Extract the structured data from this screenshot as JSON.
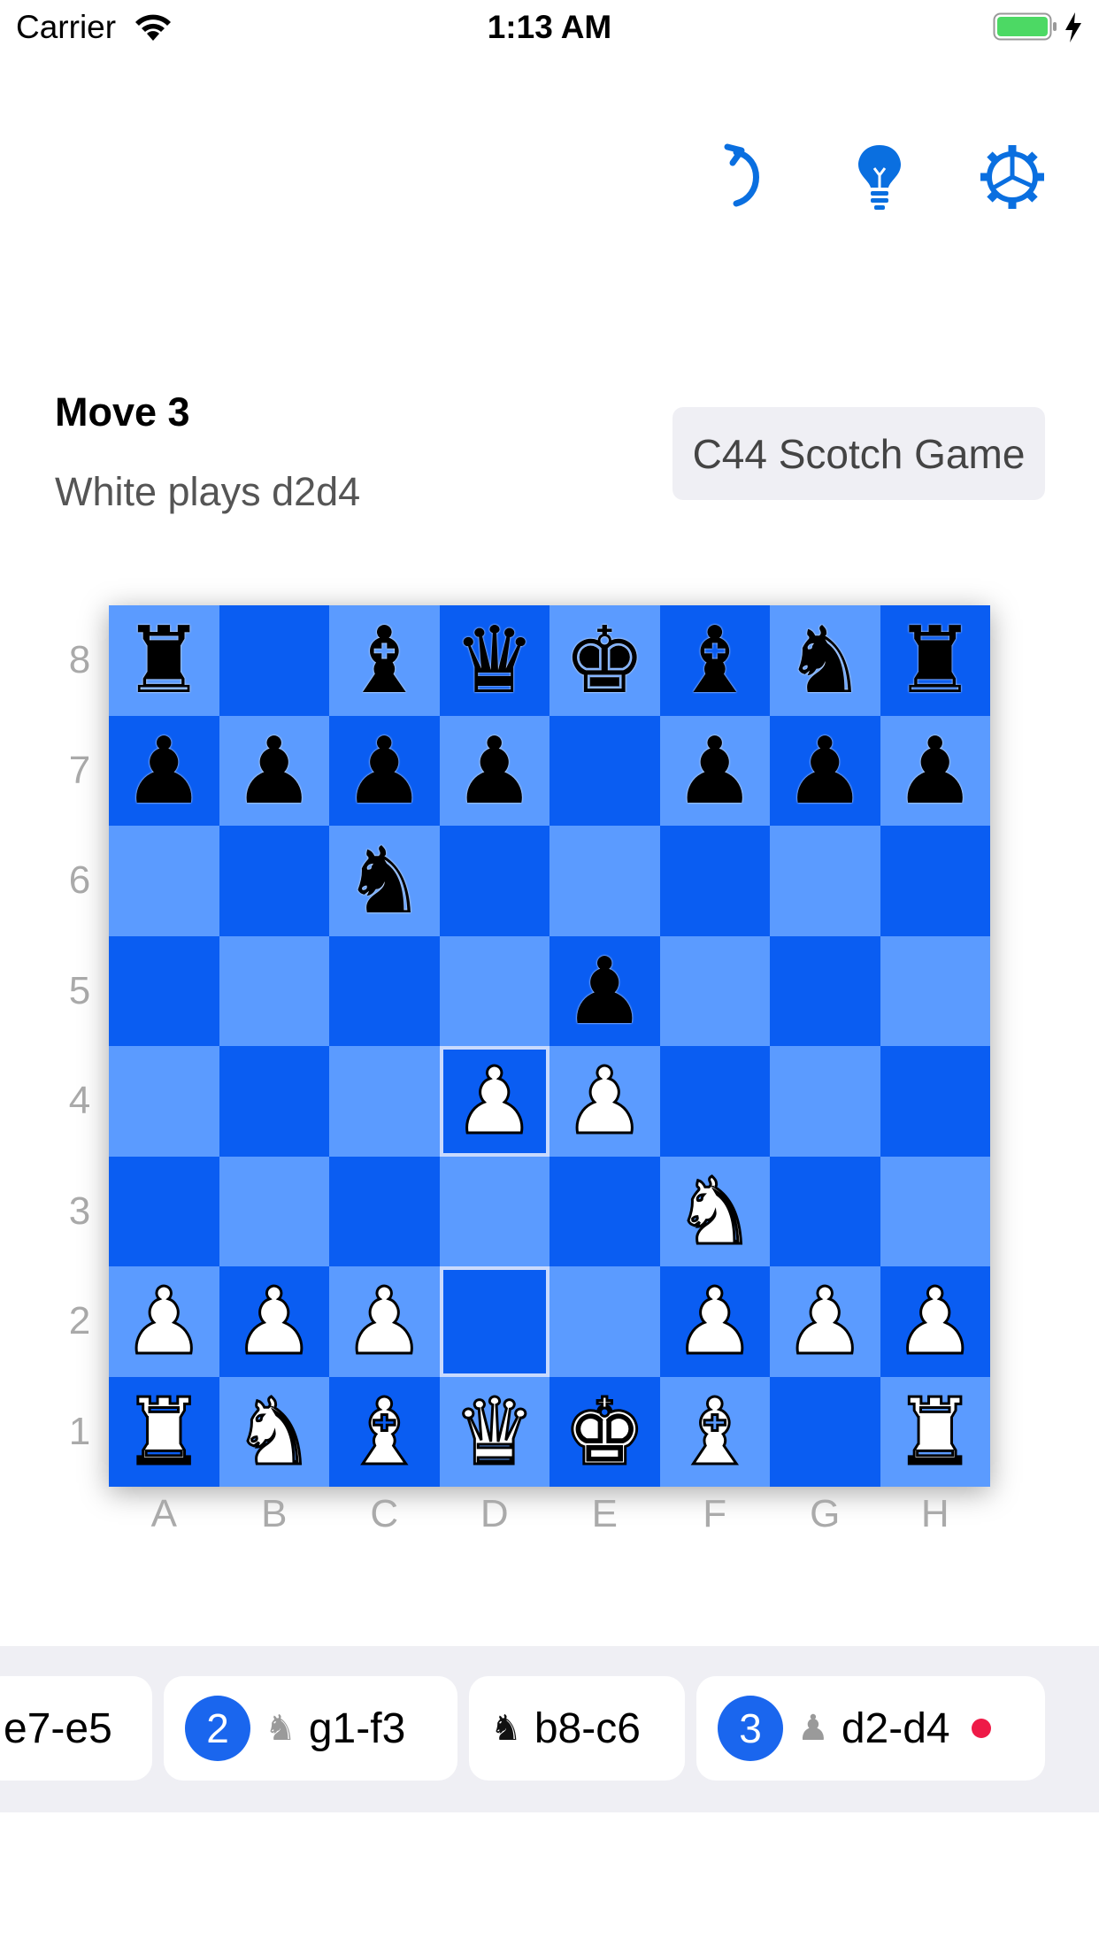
{
  "status_bar": {
    "carrier": "Carrier",
    "time": "1:13 AM",
    "battery_color": "#4cd964"
  },
  "toolbar": {
    "accent_color": "#0a6fe0",
    "icons": [
      "undo-arrow-icon",
      "hint-lightbulb-icon",
      "settings-gear-icon"
    ]
  },
  "header": {
    "title": "Move 3",
    "subtitle": "White plays d2d4",
    "opening": "C44 Scotch Game"
  },
  "board": {
    "light_color": "#5b9bff",
    "dark_color": "#0a5df2",
    "ranks": [
      "8",
      "7",
      "6",
      "5",
      "4",
      "3",
      "2",
      "1"
    ],
    "files": [
      "A",
      "B",
      "C",
      "D",
      "E",
      "F",
      "G",
      "H"
    ],
    "position": [
      [
        "r",
        "",
        "b",
        "q",
        "k",
        "b",
        "n",
        "r"
      ],
      [
        "p",
        "p",
        "p",
        "p",
        "",
        "p",
        "p",
        "p"
      ],
      [
        "",
        "",
        "n",
        "",
        "",
        "",
        "",
        ""
      ],
      [
        "",
        "",
        "",
        "",
        "p",
        "",
        "",
        ""
      ],
      [
        "",
        "",
        "",
        "P",
        "P",
        "",
        "",
        ""
      ],
      [
        "",
        "",
        "",
        "",
        "",
        "N",
        "",
        ""
      ],
      [
        "P",
        "P",
        "P",
        "",
        "",
        "P",
        "P",
        "P"
      ],
      [
        "R",
        "N",
        "B",
        "Q",
        "K",
        "B",
        "",
        "R"
      ]
    ],
    "last_move": [
      "d2",
      "d4"
    ]
  },
  "moves": [
    {
      "text": "e7-e5",
      "piece": "",
      "number": "",
      "current": false
    },
    {
      "text": "g1-f3",
      "piece": "♞",
      "number": "2",
      "current": false
    },
    {
      "text": "b8-c6",
      "piece": "♞",
      "number": "",
      "current": false
    },
    {
      "text": "d2-d4",
      "piece": "♟",
      "number": "3",
      "current": true
    }
  ]
}
